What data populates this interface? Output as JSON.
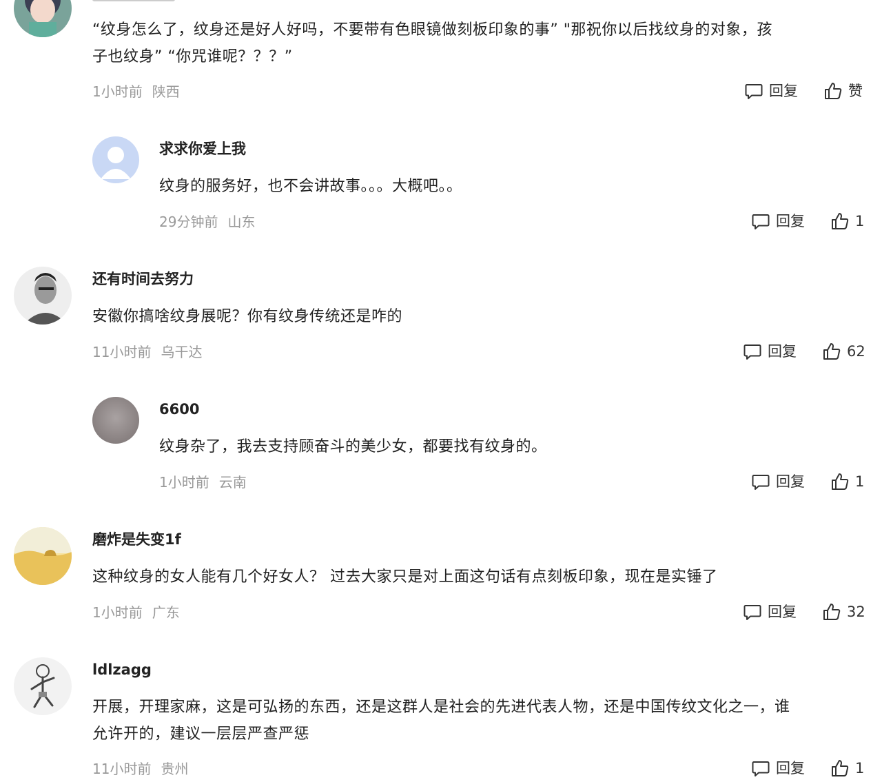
{
  "reply_label": "回复",
  "comments": [
    {
      "username": "",
      "text_line1": "“纹身怎么了，纹身还是好人好吗，不要带有色眼镜做刻板印象的事”  \"那祝你以后找纹身的对象，孩",
      "text_line2": "子也纹身”    “你咒谁呢？？？”",
      "time": "1小时前",
      "location": "陕西",
      "likes": "赞"
    },
    {
      "username": "求求你爱上我",
      "text_line1": "纹身的服务好，也不会讲故事。。。大概吧。。",
      "time": "29分钟前",
      "location": "山东",
      "likes": "1"
    },
    {
      "username": "还有时间去努力",
      "text_line1": "安徽你搞啥纹身展呢？你有纹身传统还是咋的",
      "time": "11小时前",
      "location": "乌干达",
      "likes": "62"
    },
    {
      "username": "6600",
      "text_line1": "纹身杂了，我去支持顾奋斗的美少女，都要找有纹身的。",
      "time": "1小时前",
      "location": "云南",
      "likes": "1"
    },
    {
      "username": "磨炸是失变1f",
      "text_line1": "这种纹身的女人能有几个好女人？ 过去大家只是对上面这句话有点刻板印象，现在是实锤了",
      "time": "1小时前",
      "location": "广东",
      "likes": "32"
    },
    {
      "username": "ldlzagg",
      "text_line1": "开展，开理家麻，这是可弘扬的东西，还是这群人是社会的先进代表人物，还是中国传纹文化之一，谁",
      "text_line2": "允许开的，建议一层层严查严惩",
      "time": "11小时前",
      "location": "贵州",
      "likes": "1"
    }
  ]
}
